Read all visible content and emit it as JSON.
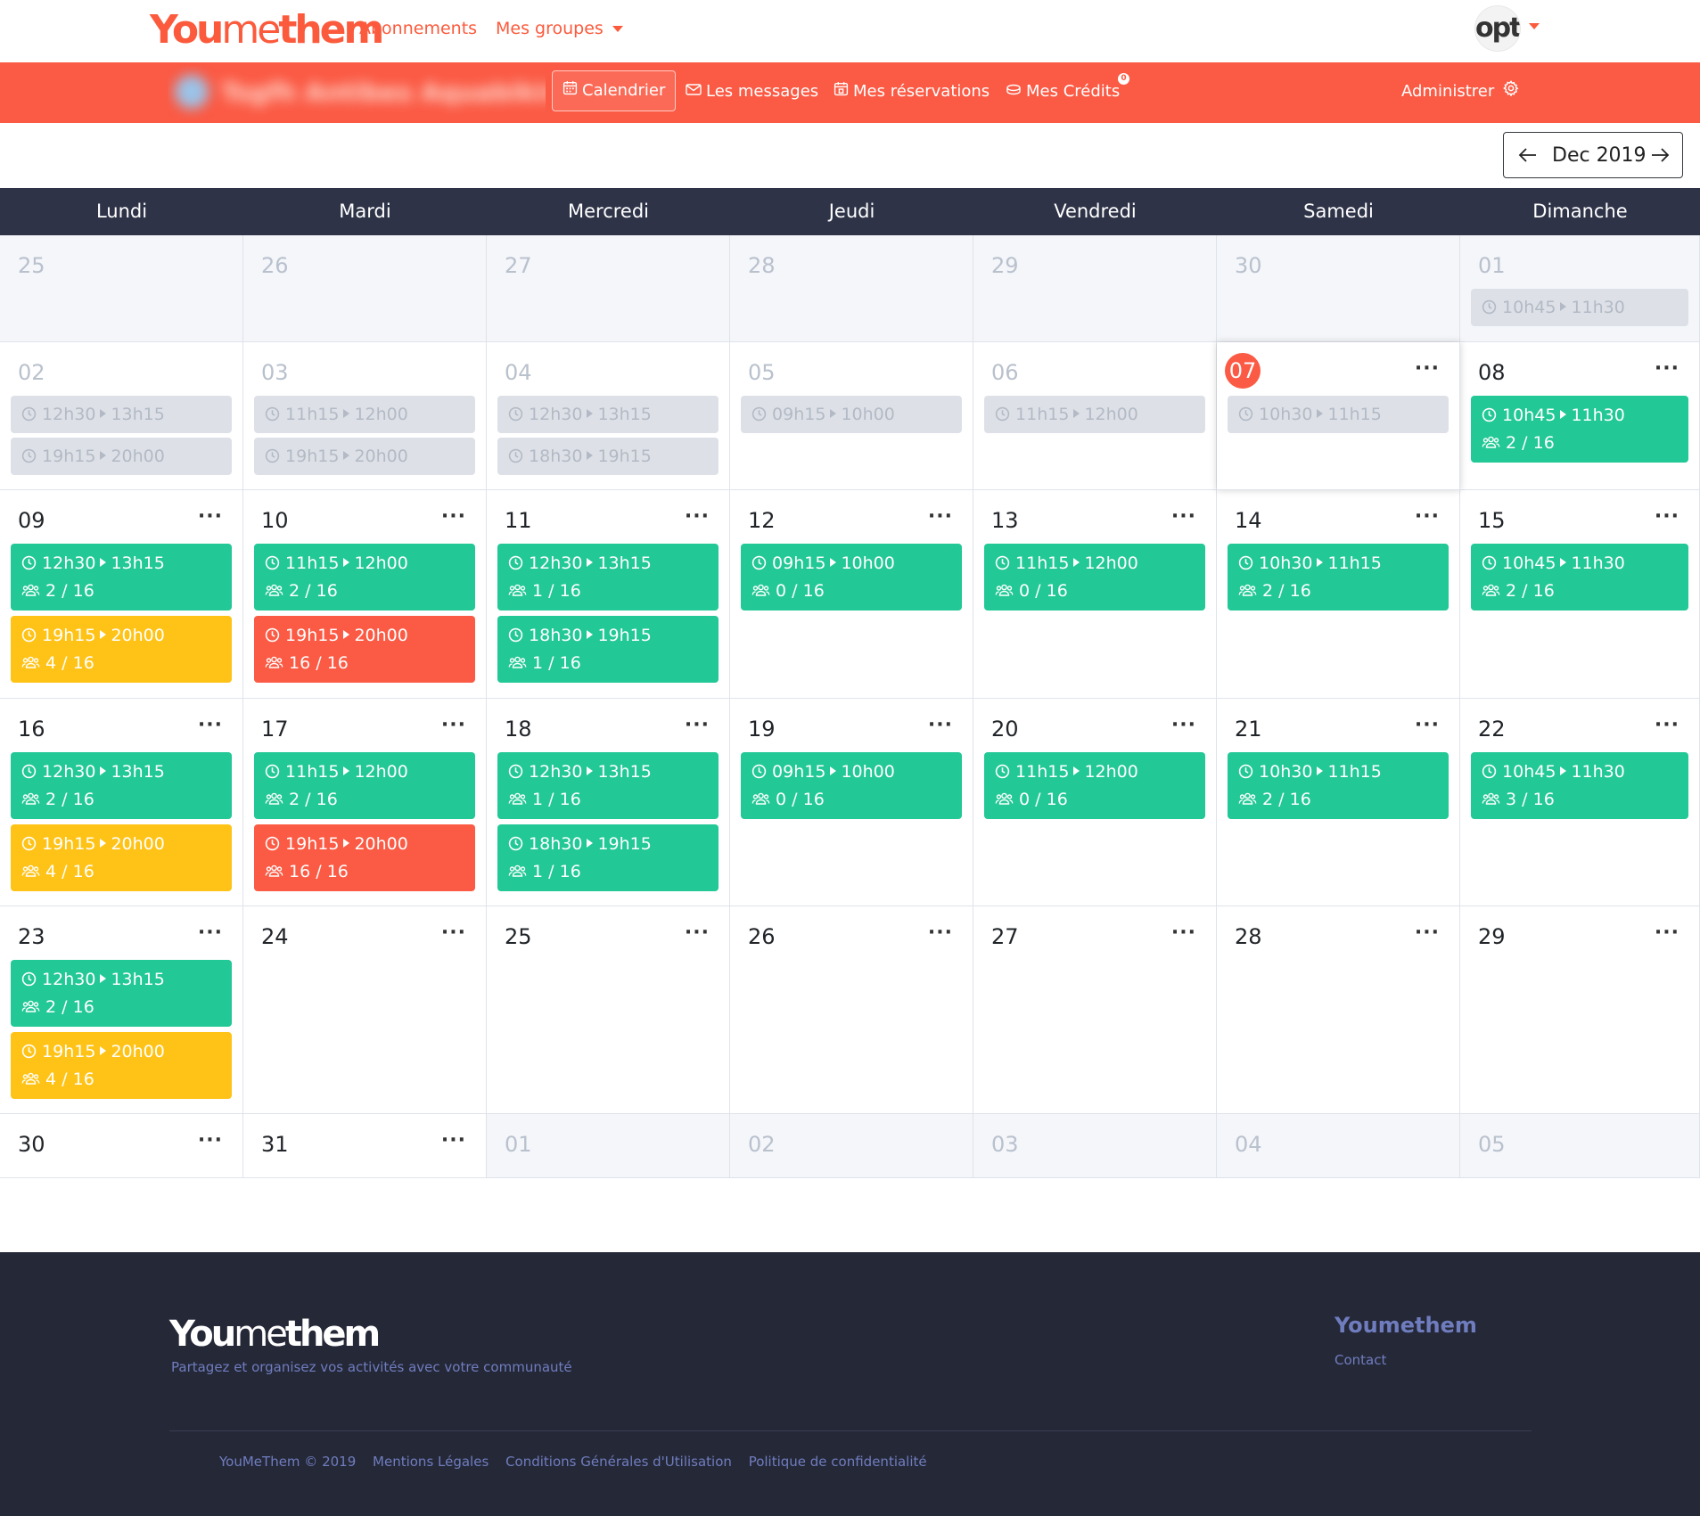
{
  "brand": {
    "logo_bold": "You",
    "logo_thin": "me",
    "logo_bold2": "them",
    "accent": "#fb5a44"
  },
  "topnav": {
    "links": [
      {
        "label": "Abonnements"
      },
      {
        "label": "Mes groupes"
      }
    ],
    "avatar_text": "opt"
  },
  "groupbar": {
    "group_name": "Tsgfh Antibes Aquabiking",
    "items": [
      {
        "label": "Calendrier",
        "icon": "calendar-icon",
        "active": true
      },
      {
        "label": "Les messages",
        "icon": "envelope-icon"
      },
      {
        "label": "Mes réservations",
        "icon": "calendar-check-icon"
      },
      {
        "label": "Mes Crédits",
        "icon": "coins-icon",
        "badge": "0"
      }
    ],
    "admin_label": "Administrer"
  },
  "month": {
    "label": "Dec 2019"
  },
  "calendar": {
    "days": [
      "Lundi",
      "Mardi",
      "Mercredi",
      "Jeudi",
      "Vendredi",
      "Samedi",
      "Dimanche"
    ],
    "weeks": [
      [
        {
          "d": "25",
          "other": true,
          "slots": []
        },
        {
          "d": "26",
          "other": true,
          "slots": []
        },
        {
          "d": "27",
          "other": true,
          "slots": []
        },
        {
          "d": "28",
          "other": true,
          "slots": []
        },
        {
          "d": "29",
          "other": true,
          "slots": []
        },
        {
          "d": "30",
          "other": true,
          "slots": []
        },
        {
          "d": "01",
          "other": true,
          "slots": [
            {
              "start": "10h45",
              "end": "11h30",
              "state": "gray"
            }
          ]
        }
      ],
      [
        {
          "d": "02",
          "past": true,
          "slots": [
            {
              "start": "12h30",
              "end": "13h15",
              "state": "gray"
            },
            {
              "start": "19h15",
              "end": "20h00",
              "state": "gray"
            }
          ]
        },
        {
          "d": "03",
          "past": true,
          "slots": [
            {
              "start": "11h15",
              "end": "12h00",
              "state": "gray"
            },
            {
              "start": "19h15",
              "end": "20h00",
              "state": "gray"
            }
          ]
        },
        {
          "d": "04",
          "past": true,
          "slots": [
            {
              "start": "12h30",
              "end": "13h15",
              "state": "gray"
            },
            {
              "start": "18h30",
              "end": "19h15",
              "state": "gray"
            }
          ]
        },
        {
          "d": "05",
          "past": true,
          "slots": [
            {
              "start": "09h15",
              "end": "10h00",
              "state": "gray"
            }
          ]
        },
        {
          "d": "06",
          "past": true,
          "slots": [
            {
              "start": "11h15",
              "end": "12h00",
              "state": "gray"
            }
          ]
        },
        {
          "d": "07",
          "today": true,
          "menu": "···",
          "slots": [
            {
              "start": "10h30",
              "end": "11h15",
              "state": "gray"
            }
          ]
        },
        {
          "d": "08",
          "menu": "···",
          "slots": [
            {
              "start": "10h45",
              "end": "11h30",
              "count": "2 / 16",
              "state": "green"
            }
          ]
        }
      ],
      [
        {
          "d": "09",
          "menu": "···",
          "slots": [
            {
              "start": "12h30",
              "end": "13h15",
              "count": "2 / 16",
              "state": "green"
            },
            {
              "start": "19h15",
              "end": "20h00",
              "count": "4 / 16",
              "state": "yellow"
            }
          ]
        },
        {
          "d": "10",
          "menu": "···",
          "slots": [
            {
              "start": "11h15",
              "end": "12h00",
              "count": "2 / 16",
              "state": "green"
            },
            {
              "start": "19h15",
              "end": "20h00",
              "count": "16 / 16",
              "state": "red"
            }
          ]
        },
        {
          "d": "11",
          "menu": "···",
          "slots": [
            {
              "start": "12h30",
              "end": "13h15",
              "count": "1 / 16",
              "state": "green"
            },
            {
              "start": "18h30",
              "end": "19h15",
              "count": "1 / 16",
              "state": "green"
            }
          ]
        },
        {
          "d": "12",
          "menu": "···",
          "slots": [
            {
              "start": "09h15",
              "end": "10h00",
              "count": "0 / 16",
              "state": "green"
            }
          ]
        },
        {
          "d": "13",
          "menu": "···",
          "slots": [
            {
              "start": "11h15",
              "end": "12h00",
              "count": "0 / 16",
              "state": "green"
            }
          ]
        },
        {
          "d": "14",
          "menu": "···",
          "slots": [
            {
              "start": "10h30",
              "end": "11h15",
              "count": "2 / 16",
              "state": "green"
            }
          ]
        },
        {
          "d": "15",
          "menu": "···",
          "slots": [
            {
              "start": "10h45",
              "end": "11h30",
              "count": "2 / 16",
              "state": "green"
            }
          ]
        }
      ],
      [
        {
          "d": "16",
          "menu": "···",
          "slots": [
            {
              "start": "12h30",
              "end": "13h15",
              "count": "2 / 16",
              "state": "green"
            },
            {
              "start": "19h15",
              "end": "20h00",
              "count": "4 / 16",
              "state": "yellow"
            }
          ]
        },
        {
          "d": "17",
          "menu": "···",
          "slots": [
            {
              "start": "11h15",
              "end": "12h00",
              "count": "2 / 16",
              "state": "green"
            },
            {
              "start": "19h15",
              "end": "20h00",
              "count": "16 / 16",
              "state": "red"
            }
          ]
        },
        {
          "d": "18",
          "menu": "···",
          "slots": [
            {
              "start": "12h30",
              "end": "13h15",
              "count": "1 / 16",
              "state": "green"
            },
            {
              "start": "18h30",
              "end": "19h15",
              "count": "1 / 16",
              "state": "green"
            }
          ]
        },
        {
          "d": "19",
          "menu": "···",
          "slots": [
            {
              "start": "09h15",
              "end": "10h00",
              "count": "0 / 16",
              "state": "green"
            }
          ]
        },
        {
          "d": "20",
          "menu": "···",
          "slots": [
            {
              "start": "11h15",
              "end": "12h00",
              "count": "0 / 16",
              "state": "green"
            }
          ]
        },
        {
          "d": "21",
          "menu": "···",
          "slots": [
            {
              "start": "10h30",
              "end": "11h15",
              "count": "2 / 16",
              "state": "green"
            }
          ]
        },
        {
          "d": "22",
          "menu": "···",
          "slots": [
            {
              "start": "10h45",
              "end": "11h30",
              "count": "3 / 16",
              "state": "green"
            }
          ]
        }
      ],
      [
        {
          "d": "23",
          "menu": "···",
          "slots": [
            {
              "start": "12h30",
              "end": "13h15",
              "count": "2 / 16",
              "state": "green"
            },
            {
              "start": "19h15",
              "end": "20h00",
              "count": "4 / 16",
              "state": "yellow"
            }
          ]
        },
        {
          "d": "24",
          "menu": "···",
          "slots": []
        },
        {
          "d": "25",
          "menu": "···",
          "slots": []
        },
        {
          "d": "26",
          "menu": "···",
          "slots": []
        },
        {
          "d": "27",
          "menu": "···",
          "slots": []
        },
        {
          "d": "28",
          "menu": "···",
          "slots": []
        },
        {
          "d": "29",
          "menu": "···",
          "slots": []
        }
      ],
      [
        {
          "d": "30",
          "menu": "···",
          "slots": []
        },
        {
          "d": "31",
          "menu": "···",
          "slots": []
        },
        {
          "d": "01",
          "other": true,
          "slots": []
        },
        {
          "d": "02",
          "other": true,
          "slots": []
        },
        {
          "d": "03",
          "other": true,
          "slots": []
        },
        {
          "d": "04",
          "other": true,
          "slots": []
        },
        {
          "d": "05",
          "other": true,
          "slots": []
        }
      ]
    ]
  },
  "footer": {
    "logo_bold": "You",
    "logo_thin": "me",
    "logo_bold2": "them",
    "tagline": "Partagez et organisez vos activités avec votre communauté",
    "brand": "Youmethem",
    "contact": "Contact",
    "links": [
      "YouMeThem © 2019",
      "Mentions Légales",
      "Conditions Générales d'Utilisation",
      "Politique de confidentialité"
    ]
  }
}
